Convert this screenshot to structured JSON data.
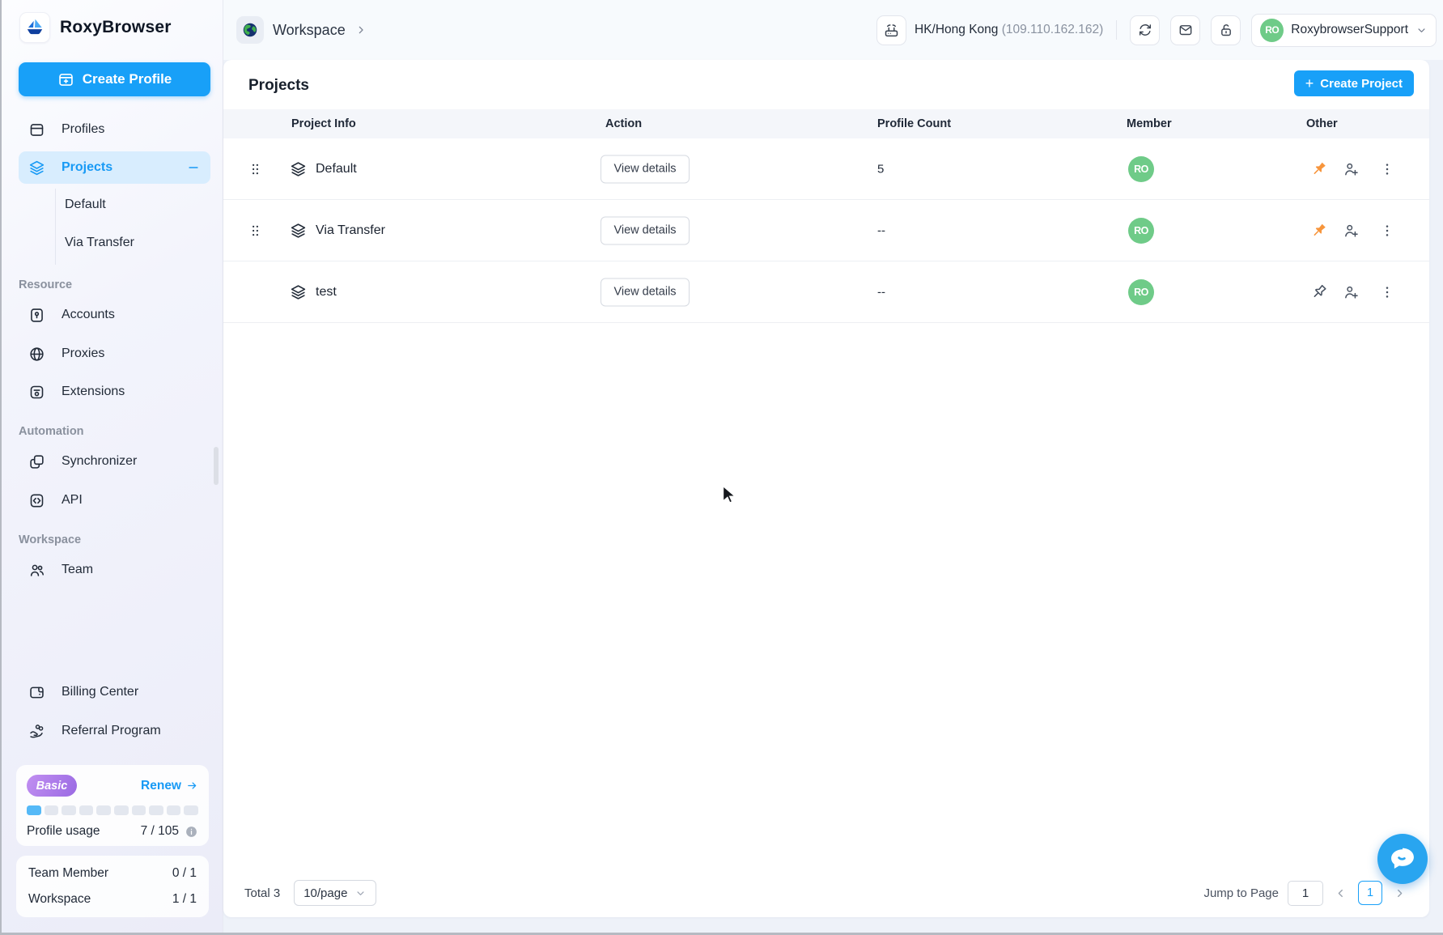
{
  "app": {
    "name": "RoxyBrowser"
  },
  "header": {
    "breadcrumb": "Workspace",
    "proxy": {
      "region": "HK/Hong Kong",
      "ip": "(109.110.162.162)"
    },
    "account": {
      "initials": "RO",
      "name": "RoxybrowserSupport"
    }
  },
  "sidebar": {
    "create_profile": "Create Profile",
    "profiles": "Profiles",
    "projects": "Projects",
    "project_children": [
      "Default",
      "Via Transfer"
    ],
    "resource_label": "Resource",
    "resource_items": [
      "Accounts",
      "Proxies",
      "Extensions"
    ],
    "automation_label": "Automation",
    "automation_items": [
      "Synchronizer",
      "API"
    ],
    "workspace_label": "Workspace",
    "workspace_items": [
      "Team"
    ],
    "billing": "Billing Center",
    "referral": "Referral Program",
    "plan": {
      "badge": "Basic",
      "renew": "Renew",
      "usage_label": "Profile usage",
      "usage_value": "7 / 105"
    },
    "stats": [
      {
        "label": "Team Member",
        "value": "0 / 1"
      },
      {
        "label": "Workspace",
        "value": "1 / 1"
      }
    ]
  },
  "main": {
    "title": "Projects",
    "create_project": "Create Project",
    "table": {
      "columns": [
        "Project Info",
        "Action",
        "Profile Count",
        "Member",
        "Other"
      ],
      "rows": [
        {
          "name": "Default",
          "action": "View details",
          "profile_count": "5",
          "member": "RO",
          "pinned": true,
          "draggable": true
        },
        {
          "name": "Via Transfer",
          "action": "View details",
          "profile_count": "--",
          "member": "RO",
          "pinned": true,
          "draggable": true
        },
        {
          "name": "test",
          "action": "View details",
          "profile_count": "--",
          "member": "RO",
          "pinned": false,
          "draggable": false
        }
      ]
    },
    "pagination": {
      "total": "Total 3",
      "page_size": "10/page",
      "jump_label": "Jump to Page",
      "jump_value": "1",
      "page": "1"
    }
  },
  "colors": {
    "primary": "#18a0f8",
    "avatar_green": "#6fcb88",
    "pin_orange": "#f7953c",
    "badge_purple": "#a97ce5",
    "active_item_bg": "#d8edfe"
  }
}
